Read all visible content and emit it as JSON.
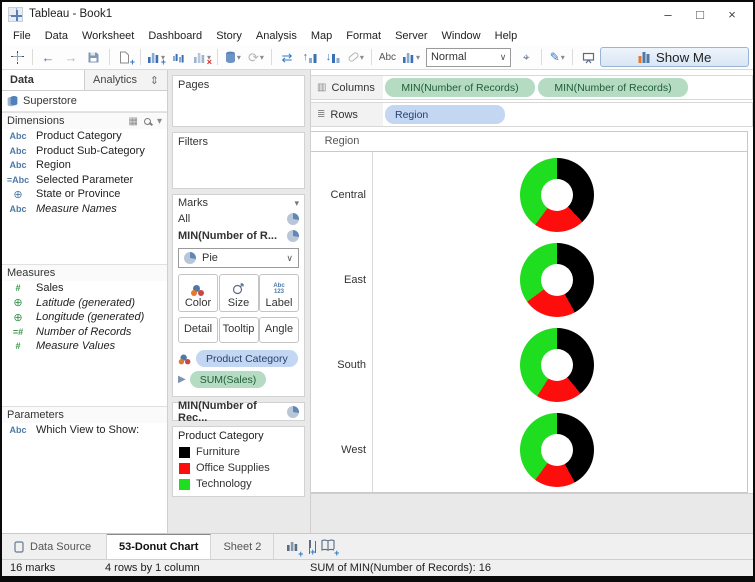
{
  "window": {
    "title": "Tableau - Book1"
  },
  "icons": {
    "undo": "←",
    "redo": "→",
    "refresh": "⟳",
    "swap_axes": "⇄",
    "sort_asc": "↑",
    "sort_desc": "↓",
    "abc": "Abc",
    "pen": "✎",
    "pin": "⌖",
    "chevron_down": "▾",
    "select_chevron": "∨",
    "minimize": "–",
    "maximize": "□",
    "close": "×",
    "grid": "▦",
    "list_small": "≣",
    "columns_glyph": "▥",
    "rows_glyph": "≣",
    "pane_toggle": "⇕",
    "angle_triangle": "▶",
    "globe": "⊕",
    "hash": "#",
    "equals": "=",
    "label_abc": "Abc",
    "label_123": "123"
  },
  "menu": {
    "items": [
      "File",
      "Data",
      "Worksheet",
      "Dashboard",
      "Story",
      "Analysis",
      "Map",
      "Format",
      "Server",
      "Window",
      "Help"
    ]
  },
  "toolbar": {
    "view_mode": "Normal",
    "show_me": "Show Me"
  },
  "data_pane": {
    "tab_data": "Data",
    "tab_analytics": "Analytics",
    "datasource": "Superstore",
    "dimensions": {
      "header": "Dimensions",
      "items": [
        {
          "icon": "Abc",
          "label": "Product Category",
          "italic": false
        },
        {
          "icon": "Abc",
          "label": "Product Sub-Category",
          "italic": false
        },
        {
          "icon": "Abc",
          "label": "Region",
          "italic": false
        },
        {
          "icon": "=Abc",
          "label": "Selected Parameter",
          "italic": false
        },
        {
          "icon": "globe",
          "label": "State or Province",
          "italic": false
        },
        {
          "icon": "Abc",
          "label": "Measure Names",
          "italic": true
        }
      ]
    },
    "measures": {
      "header": "Measures",
      "items": [
        {
          "icon": "#",
          "label": "Sales",
          "italic": false
        },
        {
          "icon": "globe",
          "label": "Latitude (generated)",
          "italic": true
        },
        {
          "icon": "globe",
          "label": "Longitude (generated)",
          "italic": true
        },
        {
          "icon": "=#",
          "label": "Number of Records",
          "italic": true
        },
        {
          "icon": "#",
          "label": "Measure Values",
          "italic": true
        }
      ]
    },
    "parameters": {
      "header": "Parameters",
      "items": [
        {
          "icon": "Abc",
          "label": "Which View to Show:"
        }
      ]
    }
  },
  "shelves": {
    "pages_label": "Pages",
    "filters_label": "Filters",
    "marks": {
      "header": "Marks",
      "row_all": "All",
      "row_selected": "MIN(Number of R...",
      "mark_type": "Pie",
      "buttons": [
        "Color",
        "Size",
        "Label",
        "Detail",
        "Tooltip",
        "Angle"
      ],
      "pills": [
        {
          "label": "Product Category",
          "type": "blue"
        },
        {
          "label": "SUM(Sales)",
          "type": "green"
        }
      ]
    },
    "collapsed_card": "MIN(Number of Rec...",
    "legend": {
      "title": "Product Category",
      "entries": [
        {
          "label": "Furniture",
          "color": "#000000"
        },
        {
          "label": "Office Supplies",
          "color": "#fe0d0d"
        },
        {
          "label": "Technology",
          "color": "#1fdd1f"
        }
      ]
    }
  },
  "columns_shelf": {
    "label": "Columns",
    "pills": [
      "MIN(Number of Records)",
      "MIN(Number of Records)"
    ]
  },
  "rows_shelf": {
    "label": "Rows",
    "pills": [
      "Region"
    ]
  },
  "chart_data": {
    "type": "pie",
    "title": "Region",
    "subtitle": "donut chart per region; angle = SUM(Sales), wedge order clockwise from top: Furniture, Office Supplies, Technology",
    "categories": [
      "Central",
      "East",
      "South",
      "West"
    ],
    "series": [
      {
        "name": "Furniture",
        "color": "#000000",
        "values": [
          38,
          42,
          39,
          42
        ]
      },
      {
        "name": "Office Supplies",
        "color": "#fe0d0d",
        "values": [
          22,
          23,
          20,
          18
        ]
      },
      {
        "name": "Technology",
        "color": "#1fdd1f",
        "values": [
          40,
          35,
          41,
          40
        ]
      }
    ],
    "units": "percent"
  },
  "sheet_tabs": {
    "datasource": "Data Source",
    "tabs": [
      "53-Donut Chart",
      "Sheet 2"
    ]
  },
  "status_bar": {
    "marks": "16 marks",
    "size": "4 rows by 1 column",
    "aggregate": "SUM of MIN(Number of Records): 16"
  }
}
